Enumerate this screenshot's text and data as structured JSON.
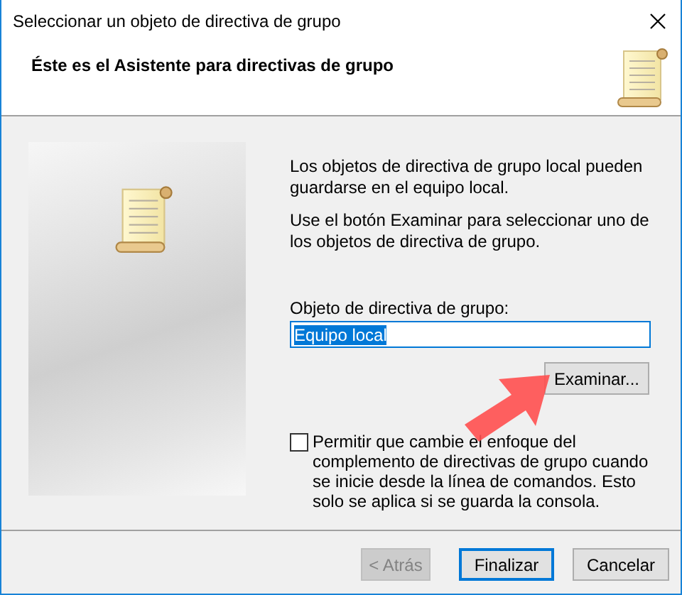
{
  "window": {
    "title": "Seleccionar un objeto de directiva de grupo"
  },
  "header": {
    "title": "Éste es el Asistente para directivas de grupo"
  },
  "description": [
    "Los objetos de directiva de grupo local pueden guardarse en el equipo local.",
    "Use el botón Examinar para seleccionar uno de los objetos de directiva de grupo."
  ],
  "field": {
    "label": "Objeto de directiva de grupo:",
    "value": "Equipo local",
    "selected": true
  },
  "browse_button": {
    "label": "Examinar..."
  },
  "option": {
    "label": "Permitir que cambie el enfoque del complemento de directivas de grupo cuando se inicie desde la línea de comandos. Esto solo se aplica si se guarda la consola.",
    "checked": false
  },
  "buttons": [
    {
      "label": "< Atrás",
      "disabled": true,
      "default": false
    },
    {
      "label": "Finalizar",
      "disabled": false,
      "default": true
    },
    {
      "label": "Cancelar",
      "disabled": false,
      "default": false
    }
  ]
}
